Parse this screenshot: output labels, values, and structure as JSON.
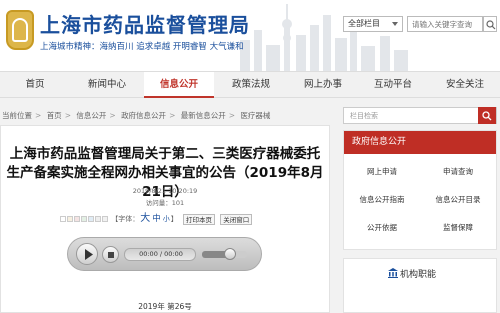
{
  "header": {
    "site_title": "上海市药品监督管理局",
    "slogan": "上海城市精神：海纳百川  追求卓越  开明睿智  大气谦和",
    "search": {
      "scope": "全部栏目",
      "placeholder": "请输入关键字查询"
    }
  },
  "nav": {
    "items": [
      {
        "label": "首页"
      },
      {
        "label": "新闻中心"
      },
      {
        "label": "信息公开",
        "active": true
      },
      {
        "label": "政策法规"
      },
      {
        "label": "网上办事"
      },
      {
        "label": "互动平台"
      },
      {
        "label": "安全关注"
      }
    ]
  },
  "breadcrumb": [
    "当前位置",
    "首页",
    "信息公开",
    "政府信息公开",
    "最新信息公开",
    "医疗器械"
  ],
  "article": {
    "title": "上海市药品监督管理局关于第二、三类医疗器械委托生产备案实施全程网办相关事宜的公告（2019年8月21日）",
    "date": "2019/8/21 10:20:19",
    "views": "访问量：101",
    "toolbar": {
      "font_label": "【字体：",
      "font_large": "大",
      "font_medium": "中",
      "font_small": "小",
      "font_close": "】",
      "print_label": "打印本页",
      "close_label": "关闭窗口"
    },
    "player_time": "00:00 / 00:00",
    "doc_no": "2019年  第26号"
  },
  "sidebar": {
    "search_placeholder": "栏目检索",
    "gov_panel": {
      "title": "政府信息公开",
      "items": [
        "网上申请",
        "申请查询",
        "信息公开指南",
        "信息公开目录",
        "公开依据",
        "监督保障"
      ]
    },
    "org_panel": {
      "title": "机构职能"
    }
  },
  "colors": {
    "brand_blue": "#1a4f9c",
    "accent_red": "#bf2e25",
    "swatches": [
      "#ffffff",
      "#f7f0e0",
      "#f4e3e3",
      "#e3f0e4",
      "#e0ecf5",
      "#eeeeee",
      "#f1f1f1"
    ]
  },
  "icons": [
    "search-icon",
    "play-icon",
    "stop-icon",
    "building-icon",
    "dropdown-arrow-icon"
  ]
}
